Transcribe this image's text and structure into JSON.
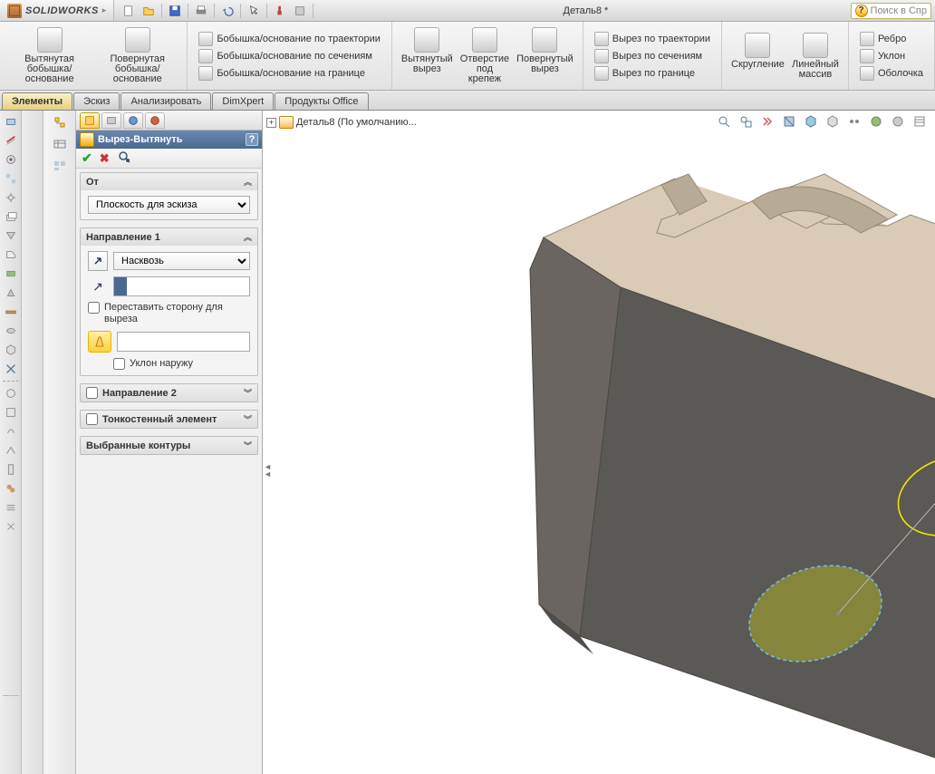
{
  "app": {
    "name": "SOLIDWORKS",
    "doc_title": "Деталь8 *",
    "search_placeholder": "Поиск в Спр"
  },
  "ribbon": {
    "g1": {
      "btn1": "Вытянутая\nбобышка/основание",
      "btn2": "Повернутая\nбобышка/основание"
    },
    "g2": [
      "Бобышка/основание по траектории",
      "Бобышка/основание по сечениям",
      "Бобышка/основание на границе"
    ],
    "g3": {
      "btn1": "Вытянутый\nвырез",
      "btn2": "Отверстие\nпод\nкрепеж",
      "btn3": "Повернутый\nвырез"
    },
    "g4": [
      "Вырез по траектории",
      "Вырез по сечениям",
      "Вырез по границе"
    ],
    "g5": {
      "btn1": "Скругление",
      "btn2": "Линейный\nмассив"
    },
    "g6": [
      "Ребро",
      "Уклон",
      "Оболочка"
    ]
  },
  "tabs": [
    "Элементы",
    "Эскиз",
    "Анализировать",
    "DimXpert",
    "Продукты Office"
  ],
  "prop": {
    "title": "Вырез-Вытянуть",
    "from_label": "От",
    "from_option": "Плоскость для эскиза",
    "dir1_label": "Направление 1",
    "dir1_option": "Насквозь",
    "flip_label": "Переставить сторону для выреза",
    "draft_label": "Уклон наружу",
    "dir2_label": "Направление 2",
    "thin_label": "Тонкостенный элемент",
    "contours_label": "Выбранные контуры"
  },
  "tree": {
    "root": "Деталь8  (По умолчанию..."
  }
}
